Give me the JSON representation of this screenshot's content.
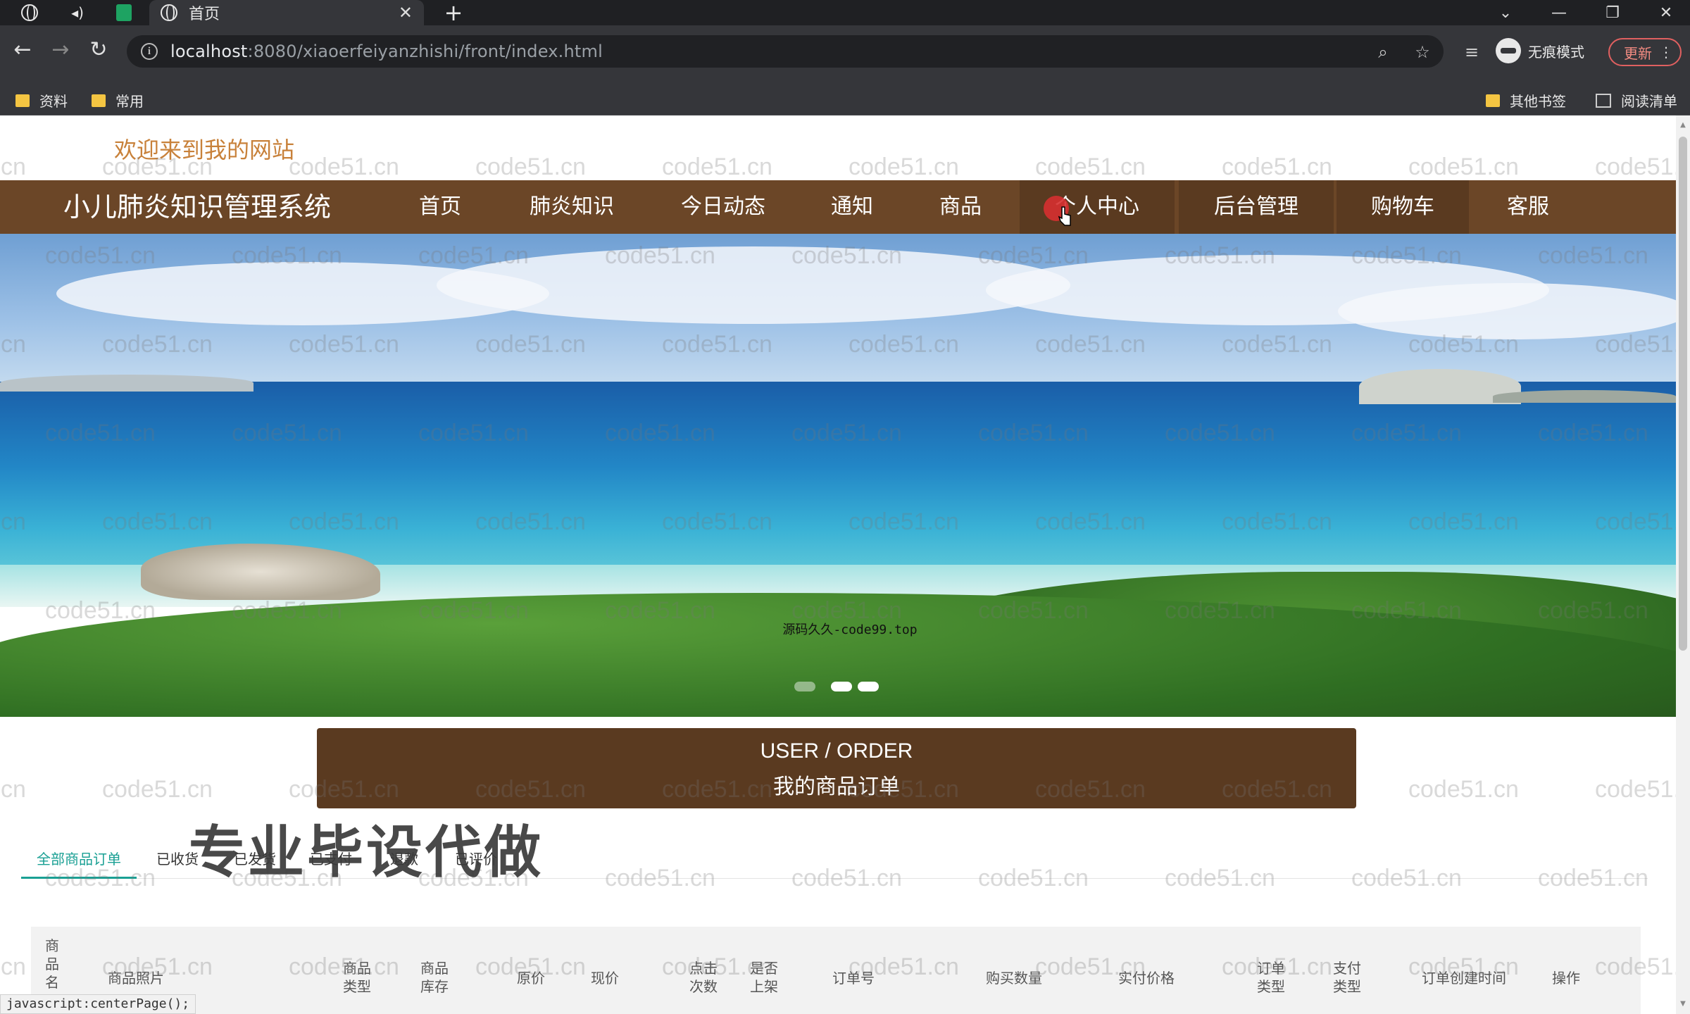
{
  "browser": {
    "tab_title": "首页",
    "url_host": "localhost",
    "url_rest": ":8080/xiaoerfeiyanzhishi/front/index.html",
    "incognito_label": "无痕模式",
    "update_label": "更新",
    "bookmarks": [
      "资料",
      "常用"
    ],
    "bookmarks_right": [
      "其他书签",
      "阅读清单"
    ]
  },
  "site": {
    "welcome": "欢迎来到我的网站",
    "title": "小儿肺炎知识管理系统",
    "nav": [
      "首页",
      "肺炎知识",
      "今日动态",
      "通知",
      "商品",
      "个人中心",
      "后台管理",
      "购物车",
      "客服"
    ],
    "active_nav": "个人中心"
  },
  "hero": {
    "caption": "源码久久-code99.top",
    "slide_count": 3
  },
  "order": {
    "title_en": "USER / ORDER",
    "title_zh": "我的商品订单",
    "tabs": [
      "全部商品订单",
      "已收货",
      "已发货",
      "已支付",
      "退款",
      "已评价"
    ],
    "active_tab": "全部商品订单",
    "columns": [
      "商品名",
      "商品照片",
      "商品类型",
      "商品库存",
      "原价",
      "现价",
      "点击次数",
      "是否上架",
      "订单号",
      "购买数量",
      "实付价格",
      "订单类型",
      "支付类型",
      "订单创建时间",
      "操作"
    ]
  },
  "overlay_text": "专业毕设代做",
  "watermark": "code51.cn",
  "status_bar": "javascript:centerPage();",
  "colors": {
    "nav_bg": "#6b4627",
    "order_header_bg": "#5a3a20",
    "welcome": "#c8813a",
    "tab_active": "#1aa094"
  }
}
